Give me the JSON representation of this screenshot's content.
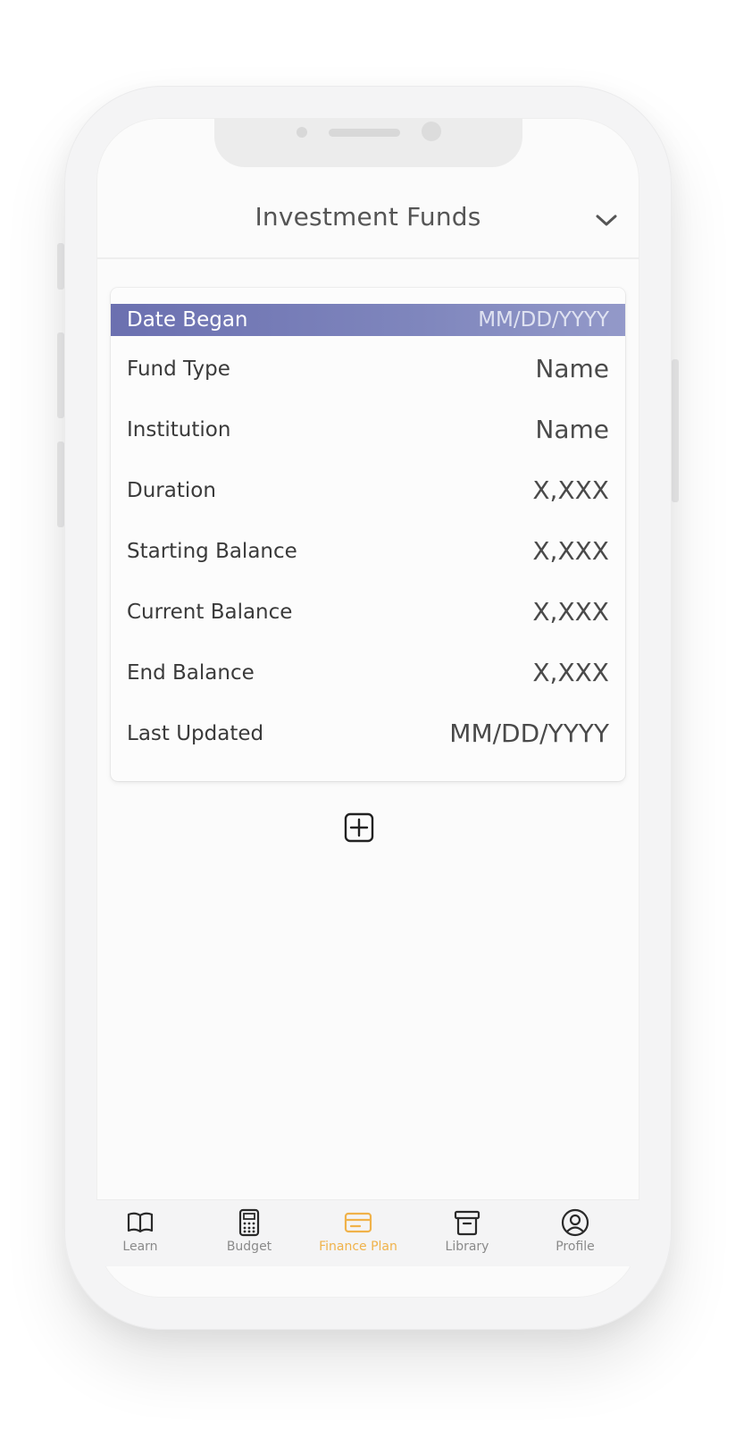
{
  "header": {
    "title": "Investment Funds"
  },
  "card": {
    "head_label": "Date Began",
    "head_value": "MM/DD/YYYY",
    "rows": [
      {
        "label": "Fund Type",
        "value": "Name"
      },
      {
        "label": "Institution",
        "value": "Name"
      },
      {
        "label": "Duration",
        "value": "X,XXX"
      },
      {
        "label": "Starting Balance",
        "value": "X,XXX"
      },
      {
        "label": "Current Balance",
        "value": "X,XXX"
      },
      {
        "label": "End Balance",
        "value": "X,XXX"
      },
      {
        "label": "Last Updated",
        "value": "MM/DD/YYYY"
      }
    ]
  },
  "actions": {
    "add_icon": "plus-square-icon"
  },
  "tabbar": {
    "active": "Finance Plan",
    "items": [
      {
        "label": "Learn",
        "icon": "book-open-icon"
      },
      {
        "label": "Budget",
        "icon": "calculator-icon"
      },
      {
        "label": "Finance Plan",
        "icon": "credit-card-icon"
      },
      {
        "label": "Library",
        "icon": "archive-icon"
      },
      {
        "label": "Profile",
        "icon": "user-circle-icon"
      }
    ]
  },
  "colors": {
    "accent": "#f0b24a",
    "header_bar": "#7077b4",
    "text": "#3a3a3a"
  }
}
